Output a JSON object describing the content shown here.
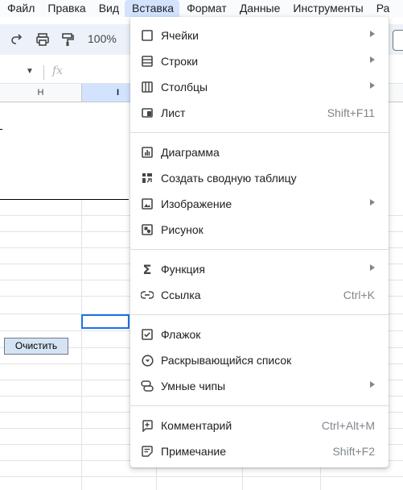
{
  "menubar": {
    "items": [
      "Файл",
      "Правка",
      "Вид",
      "Вставка",
      "Формат",
      "Данные",
      "Инструменты",
      "Ра"
    ],
    "active_index": 3
  },
  "toolbar": {
    "zoom": "100%"
  },
  "formula_bar": {
    "fx_label": "fx"
  },
  "columns": [
    "H",
    "I"
  ],
  "sheet": {
    "clear_button": "Очистить"
  },
  "insert_menu": {
    "items": [
      {
        "label": "Ячейки",
        "icon": "cells-icon",
        "submenu": true
      },
      {
        "label": "Строки",
        "icon": "rows-icon",
        "submenu": true
      },
      {
        "label": "Столбцы",
        "icon": "columns-icon",
        "submenu": true
      },
      {
        "label": "Лист",
        "icon": "sheet-icon",
        "shortcut": "Shift+F11"
      },
      {
        "label": "Диаграмма",
        "icon": "chart-icon"
      },
      {
        "label": "Создать сводную таблицу",
        "icon": "pivot-table-icon"
      },
      {
        "label": "Изображение",
        "icon": "image-icon",
        "submenu": true
      },
      {
        "label": "Рисунок",
        "icon": "drawing-icon"
      },
      {
        "label": "Функция",
        "icon": "sigma-icon",
        "submenu": true
      },
      {
        "label": "Ссылка",
        "icon": "link-icon",
        "shortcut": "Ctrl+K"
      },
      {
        "label": "Флажок",
        "icon": "checkbox-icon"
      },
      {
        "label": "Раскрывающийся список",
        "icon": "dropdown-icon"
      },
      {
        "label": "Умные чипы",
        "icon": "smart-chips-icon",
        "submenu": true
      },
      {
        "label": "Комментарий",
        "icon": "comment-icon",
        "shortcut": "Ctrl+Alt+M"
      },
      {
        "label": "Примечание",
        "icon": "note-icon",
        "shortcut": "Shift+F2"
      }
    ]
  }
}
